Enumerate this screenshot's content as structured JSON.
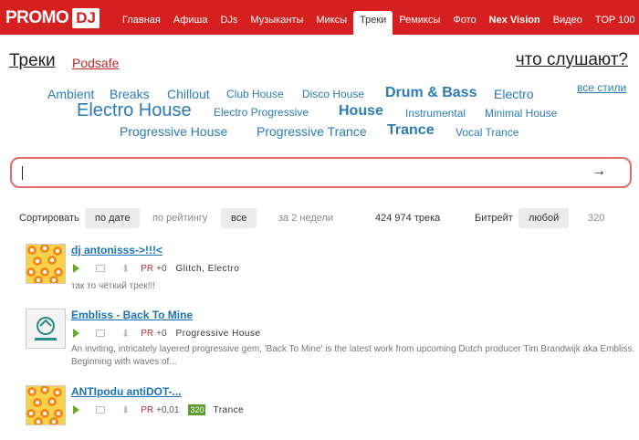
{
  "logo": {
    "promo": "PROMO",
    "dj": "DJ"
  },
  "nav": [
    {
      "label": "Главная",
      "bold": false,
      "active": false
    },
    {
      "label": "Афиша",
      "bold": false,
      "active": false
    },
    {
      "label": "DJs",
      "bold": false,
      "active": false
    },
    {
      "label": "Музыканты",
      "bold": false,
      "active": false
    },
    {
      "label": "Миксы",
      "bold": false,
      "active": false
    },
    {
      "label": "Треки",
      "bold": false,
      "active": true
    },
    {
      "label": "Ремиксы",
      "bold": false,
      "active": false
    },
    {
      "label": "Фото",
      "bold": false,
      "active": false
    },
    {
      "label": "Nex Vision",
      "bold": true,
      "active": false
    },
    {
      "label": "Видео",
      "bold": false,
      "active": false
    },
    {
      "label": "TOP 100",
      "bold": false,
      "active": false
    }
  ],
  "header": {
    "title": "Треки",
    "podsafe": "Podsafe",
    "listen": "что слушают?",
    "all_styles": "все стили"
  },
  "tags": [
    {
      "label": "Ambient",
      "weight": 1
    },
    {
      "label": "Breaks",
      "weight": 1
    },
    {
      "label": "Chillout",
      "weight": 1
    },
    {
      "label": "Club House",
      "weight": 0
    },
    {
      "label": "Disco House",
      "weight": 0
    },
    {
      "label": "Drum & Bass",
      "weight": 3
    },
    {
      "label": "Electro",
      "weight": 1
    },
    {
      "label": "Electro House",
      "weight": 4
    },
    {
      "label": "Electro Progressive",
      "weight": 0
    },
    {
      "label": "House",
      "weight": 3
    },
    {
      "label": "Instrumental",
      "weight": 0
    },
    {
      "label": "Minimal House",
      "weight": 0
    },
    {
      "label": "Progressive House",
      "weight": 1
    },
    {
      "label": "Progressive Trance",
      "weight": 1
    },
    {
      "label": "Trance",
      "weight": 3
    },
    {
      "label": "Vocal Trance",
      "weight": 0
    }
  ],
  "search": {
    "value": "",
    "arrow": "→"
  },
  "sortbar": {
    "sort_label": "Сортировать",
    "by_date": "по дате",
    "by_rating": "по рейтингу",
    "all": "все",
    "two_weeks": "за 2 недели",
    "count": "424 974 трека",
    "bitrate_label": "Битрейт",
    "any": "любой",
    "bitrate_320": "320"
  },
  "tracks": [
    {
      "title": "dj antonisss->!!!<",
      "pr_label": "PR",
      "pr_value": "+0",
      "badge": "",
      "genres": "Glitch, Electro",
      "description": "так то чёткий трек!!!",
      "thumb": "flowers"
    },
    {
      "title": "Embliss - Back To Mine",
      "pr_label": "PR",
      "pr_value": "+0",
      "badge": "",
      "genres": "Progressive House",
      "description": "An inviting, intricately layered progressive gem, 'Back To Mine' is the latest work from upcoming Dutch producer Tim Brandwijk aka Embliss.  Beginning with waves of...",
      "thumb": "label-logo"
    },
    {
      "title": "ANTIpodu antiDOT-...",
      "pr_label": "PR",
      "pr_value": "+0,01",
      "badge": "320",
      "genres": "Trance",
      "description": "",
      "thumb": "flowers"
    }
  ],
  "colors": {
    "brand_red": "#d6201f",
    "tag_blue": "#2b7cb5",
    "link_blue": "#1a72b8",
    "play_green": "#6aa82a"
  }
}
